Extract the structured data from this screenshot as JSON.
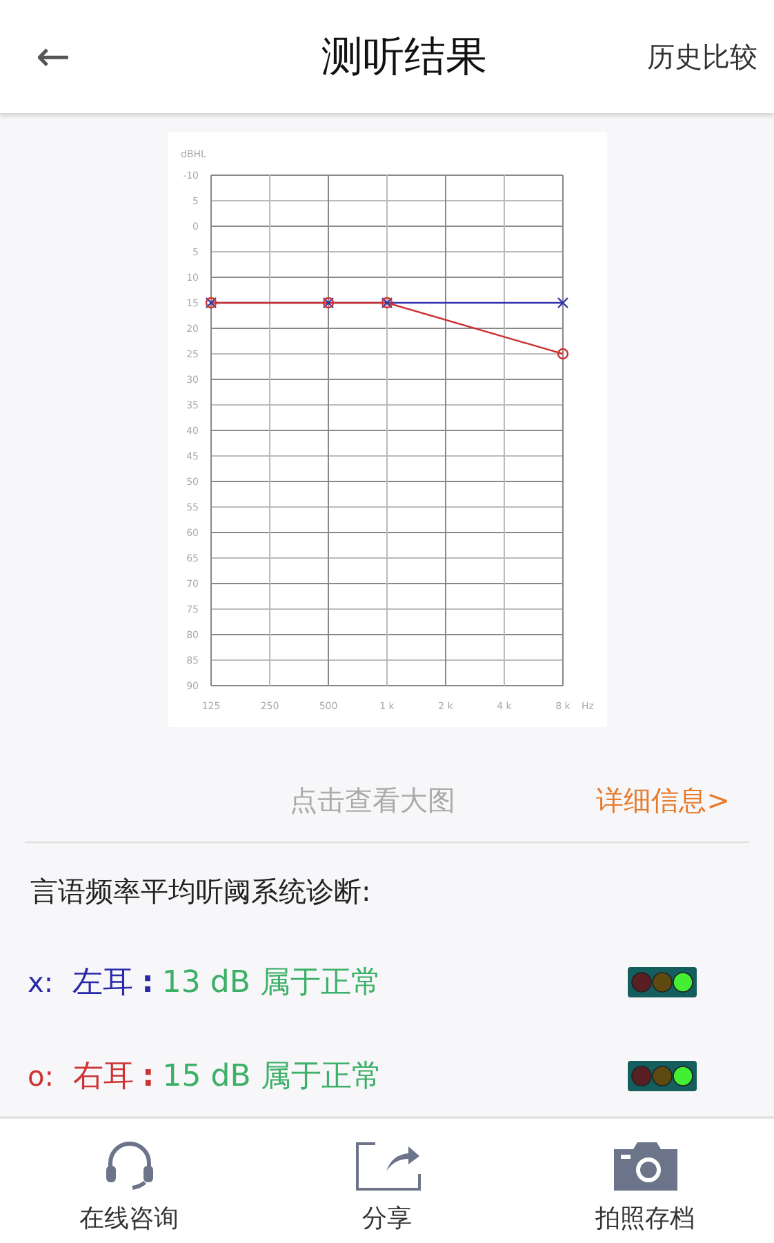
{
  "header": {
    "back": "←",
    "title": "测听结果",
    "action": "历史比较"
  },
  "audiogram": {
    "chart_data": {
      "type": "line",
      "ylabel": "dBHL",
      "xlabel": "Hz",
      "categories": [
        "125",
        "250",
        "500",
        "1 k",
        "2 k",
        "4 k",
        "8 k"
      ],
      "yticks": [
        -10,
        {
          "value": -5,
          "label": "5"
        },
        0,
        5,
        10,
        15,
        20,
        25,
        30,
        35,
        40,
        45,
        50,
        55,
        60,
        65,
        70,
        75,
        80,
        85,
        90
      ],
      "ylim": [
        90,
        -10
      ],
      "grid": true,
      "series": [
        {
          "marker": "x",
          "color": "#3333aa",
          "values": [
            15,
            null,
            15,
            15,
            null,
            null,
            15
          ]
        },
        {
          "marker": "o",
          "color": "#cc3333",
          "values": [
            15,
            null,
            15,
            15,
            null,
            null,
            25
          ]
        }
      ]
    }
  },
  "view_large": "点击查看大图",
  "details": "详细信息>",
  "diagnosis_title": "言语频率平均听阈系统诊断:",
  "ears": [
    {
      "symbol": "x:",
      "name": "左耳",
      "sep": ":",
      "result": "13 dB 属于正常",
      "color": "#2a2aa8"
    },
    {
      "symbol": "o:",
      "name": "右耳",
      "sep": ":",
      "result": "15 dB 属于正常",
      "color": "#cc3333"
    }
  ],
  "bottom_bar": [
    {
      "kind": "headset",
      "label": "在线咨询"
    },
    {
      "kind": "share",
      "label": "分享"
    },
    {
      "kind": "camera",
      "label": "拍照存档"
    }
  ]
}
